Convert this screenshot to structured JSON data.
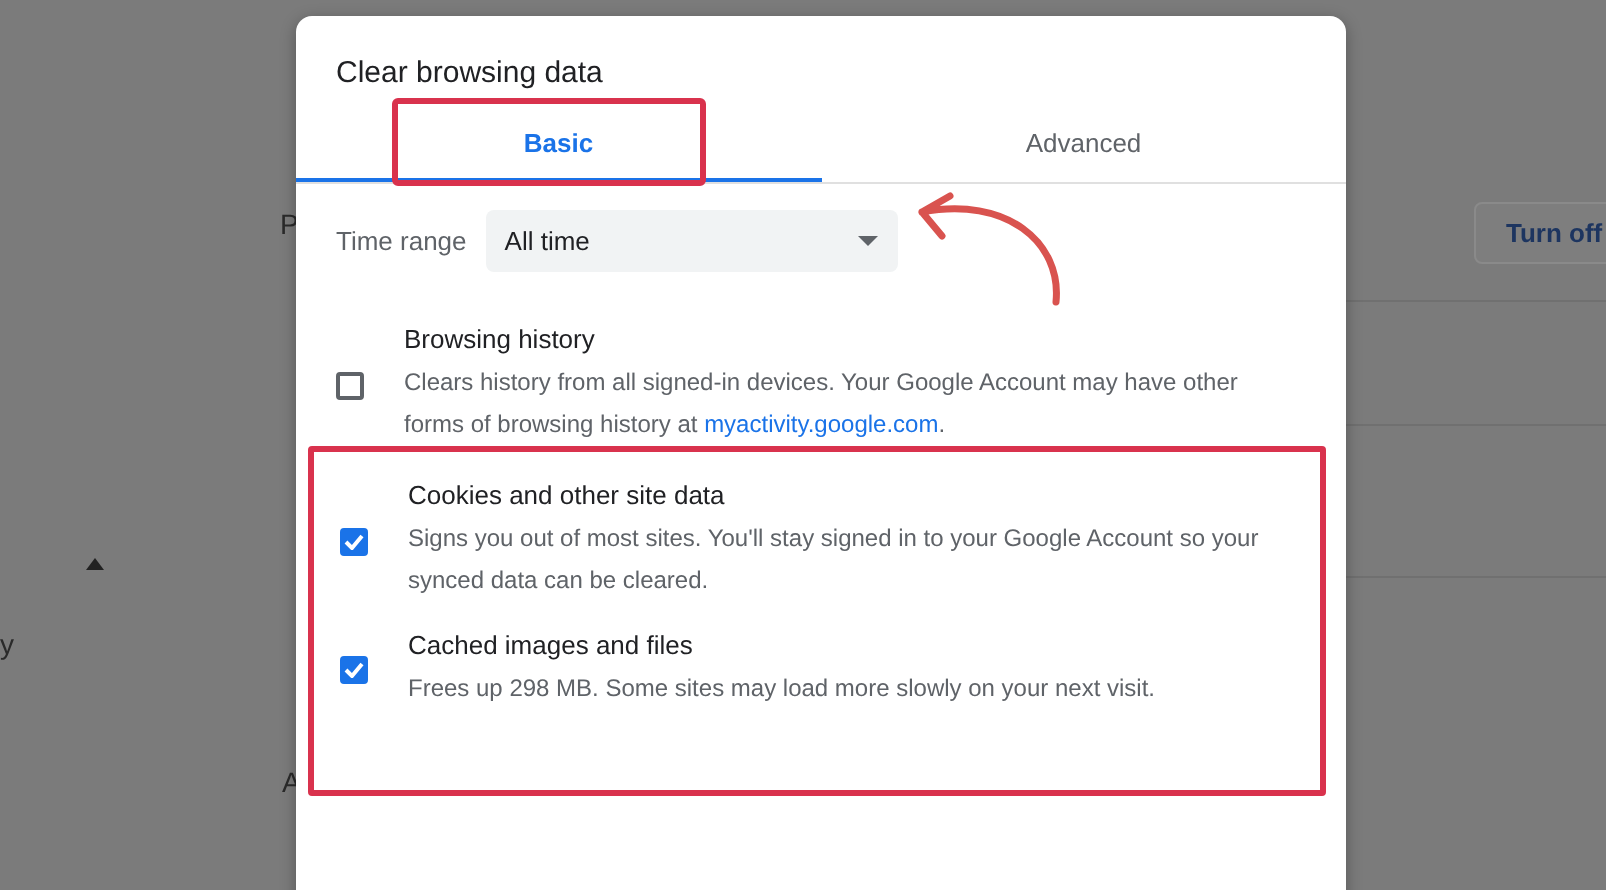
{
  "background": {
    "fragments": [
      "P",
      "y",
      "A"
    ],
    "button": "Turn off"
  },
  "dialog": {
    "title": "Clear browsing data",
    "tabs": [
      {
        "label": "Basic",
        "selected": true,
        "highlighted": true
      },
      {
        "label": "Advanced",
        "selected": false,
        "highlighted": false
      }
    ],
    "time_range": {
      "label": "Time range",
      "value": "All time",
      "pointed_at": true
    },
    "items": [
      {
        "title": "Browsing history",
        "description": "Clears history from all signed-in devices. Your Google Account may have other forms of browsing history at",
        "link": "myactivity.google.com",
        "after_link": ".",
        "checked": false,
        "highlighted": false
      },
      {
        "title": "Cookies and other site data",
        "description": "Signs you out of most sites. You'll stay signed in to your Google Account so your synced data can be cleared.",
        "checked": true,
        "highlighted": true
      },
      {
        "title": "Cached images and files",
        "description": "Frees up 298 MB. Some sites may load more slowly on your next visit.",
        "checked": true,
        "highlighted": true
      }
    ]
  }
}
